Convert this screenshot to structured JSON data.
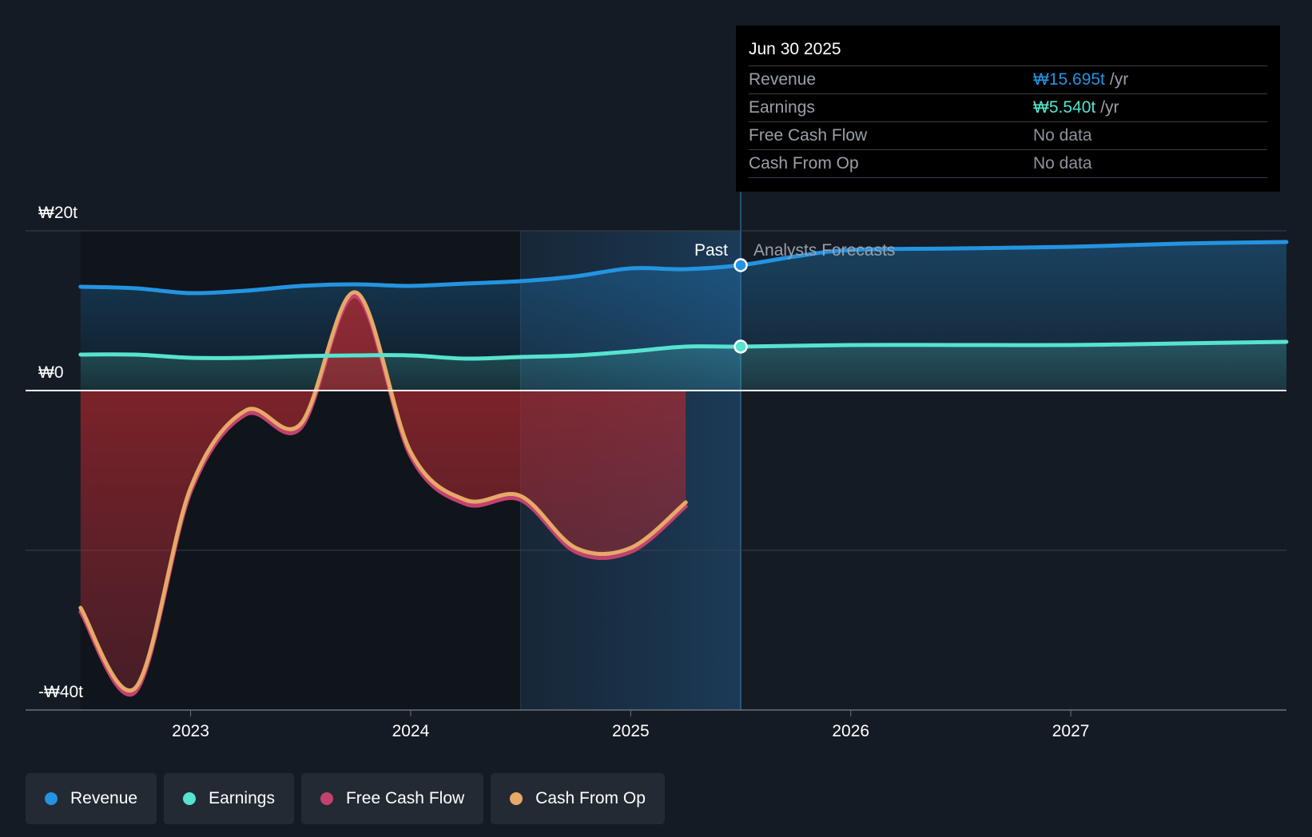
{
  "colors": {
    "background": "#151b24",
    "revenue": "#2394e1",
    "earnings": "#56e3cf",
    "free_cash_flow": "#c2416f",
    "cash_from_op": "#e6a967"
  },
  "tooltip": {
    "date": "Jun 30 2025",
    "rows": [
      {
        "label": "Revenue",
        "value": "₩15.695t",
        "unit": "/yr",
        "color": "#2394e1"
      },
      {
        "label": "Earnings",
        "value": "₩5.540t",
        "unit": "/yr",
        "color": "#56e3cf"
      },
      {
        "label": "Free Cash Flow",
        "value": "No data",
        "unit": "",
        "color": ""
      },
      {
        "label": "Cash From Op",
        "value": "No data",
        "unit": "",
        "color": ""
      }
    ]
  },
  "labels": {
    "past": "Past",
    "forecast": "Analysts Forecasts"
  },
  "legend": [
    {
      "label": "Revenue",
      "color": "#2394e1"
    },
    {
      "label": "Earnings",
      "color": "#56e3cf"
    },
    {
      "label": "Free Cash Flow",
      "color": "#c2416f"
    },
    {
      "label": "Cash From Op",
      "color": "#e6a967"
    }
  ],
  "chart_data": {
    "type": "line",
    "y_tick_labels": [
      "₩20t",
      "₩0",
      "-₩40t"
    ],
    "y_ticks": [
      20,
      0,
      -40
    ],
    "ylim": [
      -40,
      20
    ],
    "grid_lines": [
      20,
      -20,
      -40
    ],
    "x_tick_labels": [
      "2023",
      "2024",
      "2025",
      "2026",
      "2027"
    ],
    "x_ticks": [
      2023.0,
      2024.0,
      2025.0,
      2026.0,
      2027.0
    ],
    "xlim": [
      2022.25,
      2027.98
    ],
    "highlight_start": 2024.5,
    "past_end": 2025.5,
    "series": [
      {
        "name": "Revenue",
        "color": "#2394e1",
        "fill": true,
        "x": [
          2022.5,
          2022.75,
          2023.0,
          2023.25,
          2023.5,
          2023.75,
          2024.0,
          2024.25,
          2024.5,
          2024.75,
          2025.0,
          2025.25,
          2025.5,
          2025.75,
          2026.0,
          2026.5,
          2027.0,
          2027.5,
          2027.98
        ],
        "y": [
          13.0,
          12.8,
          12.2,
          12.5,
          13.1,
          13.3,
          13.1,
          13.4,
          13.7,
          14.3,
          15.3,
          15.2,
          15.7,
          16.8,
          17.6,
          17.8,
          18.0,
          18.4,
          18.6
        ]
      },
      {
        "name": "Earnings",
        "color": "#56e3cf",
        "fill": true,
        "x": [
          2022.5,
          2022.75,
          2023.0,
          2023.25,
          2023.5,
          2023.75,
          2024.0,
          2024.25,
          2024.5,
          2024.75,
          2025.0,
          2025.25,
          2025.5,
          2026.0,
          2026.5,
          2027.0,
          2027.5,
          2027.98
        ],
        "y": [
          4.5,
          4.5,
          4.1,
          4.1,
          4.3,
          4.4,
          4.4,
          4.0,
          4.2,
          4.4,
          4.9,
          5.5,
          5.5,
          5.7,
          5.7,
          5.7,
          5.9,
          6.1
        ]
      },
      {
        "name": "Free Cash Flow",
        "color": "#c2416f",
        "fill": true,
        "x": [
          2022.5,
          2022.75,
          2023.0,
          2023.25,
          2023.5,
          2023.75,
          2024.0,
          2024.25,
          2024.5,
          2024.75,
          2025.0,
          2025.25
        ],
        "y": [
          -27.5,
          -37.5,
          -12.5,
          -2.8,
          -4.5,
          12.0,
          -8.0,
          -14.0,
          -13.5,
          -20.0,
          -20.0,
          -14.3
        ]
      },
      {
        "name": "Cash From Op",
        "color": "#e6a967",
        "fill": false,
        "x": [
          2022.5,
          2022.75,
          2023.0,
          2023.25,
          2023.5,
          2023.75,
          2024.0,
          2024.25,
          2024.5,
          2024.75,
          2025.0,
          2025.25
        ],
        "y": [
          -27.2,
          -37.2,
          -12.2,
          -2.5,
          -4.2,
          12.3,
          -7.7,
          -13.7,
          -13.2,
          -19.7,
          -19.7,
          -14.0
        ]
      }
    ],
    "markers": [
      {
        "series": "Revenue",
        "x": 2025.5,
        "y": 15.7
      },
      {
        "series": "Earnings",
        "x": 2025.5,
        "y": 5.5
      }
    ]
  }
}
